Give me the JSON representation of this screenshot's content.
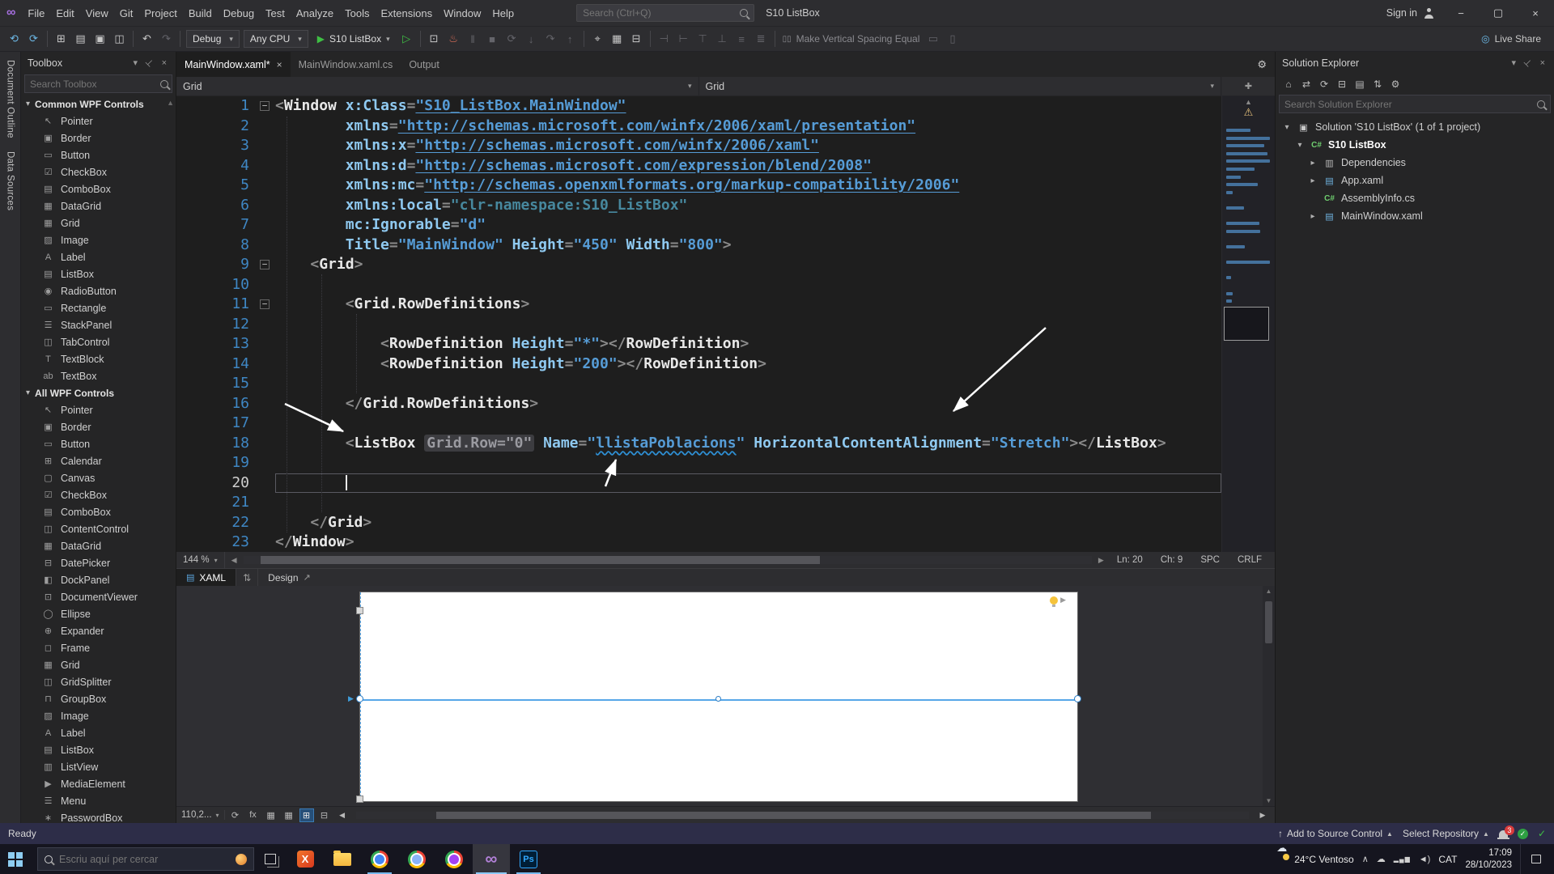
{
  "colors": {
    "accent": "#007acc",
    "statusbar-bg": "#2d2d48",
    "taskbar-bg": "#15151f",
    "tok-element": "#e8e8e8",
    "tok-attr": "#8fc9f0",
    "tok-value": "#569cd6",
    "tok-delim": "#8a8a8a",
    "tok-dim": "#47889e"
  },
  "icons": {
    "nav-back": "⟲",
    "nav-forward": "⟳",
    "new-project": "⊞",
    "open-file": "▤",
    "save": "▣",
    "save-all": "◫",
    "undo": "↶",
    "redo": "↷",
    "run": "▶",
    "run-outline": "▷",
    "chevron-down": "▾",
    "attach": "⊡",
    "hot-reload": "♨",
    "pause": "‖",
    "stop": "■",
    "restart": "⟳",
    "step-into": "↓",
    "step-over": "↷",
    "step-out": "↑",
    "target": "⌖",
    "device": "▦",
    "split": "⊟",
    "align-1": "⊣",
    "align-2": "⊢",
    "align-3": "⊤",
    "align-4": "⊥",
    "align-5": "≡",
    "align-6": "≣",
    "spacing": "▯▯",
    "misc-1": "▭",
    "misc-2": "▯",
    "live-share": "◎",
    "gear": "⚙",
    "split-editor": "✚",
    "warning": "⚠",
    "scroll-up": "▲",
    "scroll-down": "▼",
    "swap": "⇅",
    "popout": "↗",
    "xaml-doc": "▤",
    "home": "⌂",
    "switch-view": "⇄",
    "refresh": "⟳",
    "collapse-all": "⊟",
    "show-all": "▤",
    "sync": "⇅",
    "properties": "⚙",
    "menu-chevron": "▾",
    "close": "×",
    "left": "◀",
    "right": "▶",
    "tray-chevron": "∧",
    "onedrive": "☁",
    "network": "▂▄▆",
    "volume": "◄)",
    "publish": "↑"
  },
  "titlebar": {
    "menus": [
      "File",
      "Edit",
      "View",
      "Git",
      "Project",
      "Build",
      "Debug",
      "Test",
      "Analyze",
      "Tools",
      "Extensions",
      "Window",
      "Help"
    ],
    "search_placeholder": "Search (Ctrl+Q)",
    "window_title": "S10 ListBox",
    "sign_in": "Sign in",
    "window_controls": {
      "minimize": "−",
      "maximize": "▢",
      "close": "×"
    }
  },
  "toolbar": {
    "debug_target": "Debug",
    "platform": "Any CPU",
    "run_label": "S10 ListBox",
    "spacing_label": "Make Vertical Spacing Equal",
    "live_share": "Live Share"
  },
  "side_strip": {
    "tabs": [
      "Document Outline",
      "Data Sources"
    ]
  },
  "toolbox": {
    "title": "Toolbox",
    "search_placeholder": "Search Toolbox",
    "groups": [
      {
        "label": "Common WPF Controls",
        "items": [
          {
            "icon": "↖",
            "label": "Pointer"
          },
          {
            "icon": "▣",
            "label": "Border"
          },
          {
            "icon": "▭",
            "label": "Button"
          },
          {
            "icon": "☑",
            "label": "CheckBox"
          },
          {
            "icon": "▤",
            "label": "ComboBox"
          },
          {
            "icon": "▦",
            "label": "DataGrid"
          },
          {
            "icon": "▦",
            "label": "Grid"
          },
          {
            "icon": "▨",
            "label": "Image"
          },
          {
            "icon": "A",
            "label": "Label"
          },
          {
            "icon": "▤",
            "label": "ListBox"
          },
          {
            "icon": "◉",
            "label": "RadioButton"
          },
          {
            "icon": "▭",
            "label": "Rectangle"
          },
          {
            "icon": "☰",
            "label": "StackPanel"
          },
          {
            "icon": "◫",
            "label": "TabControl"
          },
          {
            "icon": "T",
            "label": "TextBlock"
          },
          {
            "icon": "ab",
            "label": "TextBox"
          }
        ]
      },
      {
        "label": "All WPF Controls",
        "items": [
          {
            "icon": "↖",
            "label": "Pointer"
          },
          {
            "icon": "▣",
            "label": "Border"
          },
          {
            "icon": "▭",
            "label": "Button"
          },
          {
            "icon": "⊞",
            "label": "Calendar"
          },
          {
            "icon": "▢",
            "label": "Canvas"
          },
          {
            "icon": "☑",
            "label": "CheckBox"
          },
          {
            "icon": "▤",
            "label": "ComboBox"
          },
          {
            "icon": "◫",
            "label": "ContentControl"
          },
          {
            "icon": "▦",
            "label": "DataGrid"
          },
          {
            "icon": "⊟",
            "label": "DatePicker"
          },
          {
            "icon": "◧",
            "label": "DockPanel"
          },
          {
            "icon": "⊡",
            "label": "DocumentViewer"
          },
          {
            "icon": "◯",
            "label": "Ellipse"
          },
          {
            "icon": "⊕",
            "label": "Expander"
          },
          {
            "icon": "◻",
            "label": "Frame"
          },
          {
            "icon": "▦",
            "label": "Grid"
          },
          {
            "icon": "◫",
            "label": "GridSplitter"
          },
          {
            "icon": "⊓",
            "label": "GroupBox"
          },
          {
            "icon": "▨",
            "label": "Image"
          },
          {
            "icon": "A",
            "label": "Label"
          },
          {
            "icon": "▤",
            "label": "ListBox"
          },
          {
            "icon": "▥",
            "label": "ListView"
          },
          {
            "icon": "▶",
            "label": "MediaElement"
          },
          {
            "icon": "☰",
            "label": "Menu"
          },
          {
            "icon": "∗",
            "label": "PasswordBox"
          }
        ]
      }
    ]
  },
  "editor": {
    "tabs": [
      {
        "label": "MainWindow.xaml*",
        "active": true
      },
      {
        "label": "MainWindow.xaml.cs",
        "active": false
      },
      {
        "label": "Output",
        "active": false
      }
    ],
    "breadcrumb": [
      "Grid",
      "Grid"
    ],
    "zoom": "144 %",
    "cursor_status": {
      "line": "Ln: 20",
      "column": "Ch: 9",
      "mode": "SPC",
      "eol": "CRLF"
    },
    "split_tabs": {
      "xaml": "XAML",
      "design": "Design"
    },
    "code_lines": [
      {
        "n": 1,
        "fold": true,
        "seg": [
          [
            "<",
            "d"
          ],
          [
            "Window",
            "e"
          ],
          [
            " ",
            "p"
          ],
          [
            "x:Class",
            "a"
          ],
          [
            "=",
            "d"
          ],
          [
            "\"S10_ListBox.MainWindow\"",
            "u"
          ]
        ]
      },
      {
        "n": 2,
        "seg": [
          [
            "        ",
            "p"
          ],
          [
            "xmlns",
            "a"
          ],
          [
            "=",
            "d"
          ],
          [
            "\"http://schemas.microsoft.com/winfx/2006/xaml/presentation\"",
            "u"
          ]
        ]
      },
      {
        "n": 3,
        "seg": [
          [
            "        ",
            "p"
          ],
          [
            "xmlns:x",
            "a"
          ],
          [
            "=",
            "d"
          ],
          [
            "\"http://schemas.microsoft.com/winfx/2006/xaml\"",
            "u"
          ]
        ]
      },
      {
        "n": 4,
        "seg": [
          [
            "        ",
            "p"
          ],
          [
            "xmlns:d",
            "a"
          ],
          [
            "=",
            "d"
          ],
          [
            "\"http://schemas.microsoft.com/expression/blend/2008\"",
            "u"
          ]
        ]
      },
      {
        "n": 5,
        "seg": [
          [
            "        ",
            "p"
          ],
          [
            "xmlns:mc",
            "a"
          ],
          [
            "=",
            "d"
          ],
          [
            "\"http://schemas.openxmlformats.org/markup-compatibility/2006\"",
            "u"
          ]
        ]
      },
      {
        "n": 6,
        "seg": [
          [
            "        ",
            "p"
          ],
          [
            "xmlns:local",
            "a"
          ],
          [
            "=",
            "d"
          ],
          [
            "\"clr-namespace:S10_ListBox\"",
            "m"
          ]
        ]
      },
      {
        "n": 7,
        "seg": [
          [
            "        ",
            "p"
          ],
          [
            "mc:Ignorable",
            "a"
          ],
          [
            "=",
            "d"
          ],
          [
            "\"d\"",
            "v"
          ]
        ]
      },
      {
        "n": 8,
        "seg": [
          [
            "        ",
            "p"
          ],
          [
            "Title",
            "a"
          ],
          [
            "=",
            "d"
          ],
          [
            "\"MainWindow\"",
            "v"
          ],
          [
            " ",
            "p"
          ],
          [
            "Height",
            "a"
          ],
          [
            "=",
            "d"
          ],
          [
            "\"450\"",
            "v"
          ],
          [
            " ",
            "p"
          ],
          [
            "Width",
            "a"
          ],
          [
            "=",
            "d"
          ],
          [
            "\"800\"",
            "v"
          ],
          [
            ">",
            "d"
          ]
        ]
      },
      {
        "n": 9,
        "fold": true,
        "seg": [
          [
            "    ",
            "p"
          ],
          [
            "<",
            "d"
          ],
          [
            "Grid",
            "e"
          ],
          [
            ">",
            "d"
          ]
        ]
      },
      {
        "n": 10,
        "seg": []
      },
      {
        "n": 11,
        "fold": true,
        "seg": [
          [
            "        ",
            "p"
          ],
          [
            "<",
            "d"
          ],
          [
            "Grid.RowDefinitions",
            "e"
          ],
          [
            ">",
            "d"
          ]
        ]
      },
      {
        "n": 12,
        "seg": []
      },
      {
        "n": 13,
        "seg": [
          [
            "            ",
            "p"
          ],
          [
            "<",
            "d"
          ],
          [
            "RowDefinition",
            "e"
          ],
          [
            " ",
            "p"
          ],
          [
            "Height",
            "a"
          ],
          [
            "=",
            "d"
          ],
          [
            "\"*\"",
            "v"
          ],
          [
            ">",
            "d"
          ],
          [
            "</",
            "d"
          ],
          [
            "RowDefinition",
            "e"
          ],
          [
            ">",
            "d"
          ]
        ]
      },
      {
        "n": 14,
        "seg": [
          [
            "            ",
            "p"
          ],
          [
            "<",
            "d"
          ],
          [
            "RowDefinition",
            "e"
          ],
          [
            " ",
            "p"
          ],
          [
            "Height",
            "a"
          ],
          [
            "=",
            "d"
          ],
          [
            "\"200\"",
            "v"
          ],
          [
            ">",
            "d"
          ],
          [
            "</",
            "d"
          ],
          [
            "RowDefinition",
            "e"
          ],
          [
            ">",
            "d"
          ]
        ]
      },
      {
        "n": 15,
        "seg": []
      },
      {
        "n": 16,
        "seg": [
          [
            "        ",
            "p"
          ],
          [
            "</",
            "d"
          ],
          [
            "Grid.RowDefinitions",
            "e"
          ],
          [
            ">",
            "d"
          ]
        ]
      },
      {
        "n": 17,
        "seg": []
      },
      {
        "n": 18,
        "seg": [
          [
            "        ",
            "p"
          ],
          [
            "<",
            "d"
          ],
          [
            "ListBox",
            "e"
          ],
          [
            " ",
            "p"
          ],
          [
            "Grid.Row=\"0\"",
            "g"
          ],
          [
            " ",
            "p"
          ],
          [
            "Name",
            "a"
          ],
          [
            "=",
            "d"
          ],
          [
            "\"",
            "v"
          ],
          [
            "llistaPoblacions",
            "w"
          ],
          [
            "\"",
            "v"
          ],
          [
            " ",
            "p"
          ],
          [
            "HorizontalContentAlignment",
            "a"
          ],
          [
            "=",
            "d"
          ],
          [
            "\"Stretch\"",
            "v"
          ],
          [
            ">",
            "d"
          ],
          [
            "</",
            "d"
          ],
          [
            "ListBox",
            "e"
          ],
          [
            ">",
            "d"
          ]
        ]
      },
      {
        "n": 19,
        "seg": []
      },
      {
        "n": 20,
        "cur": true,
        "caret": true,
        "seg": [
          [
            "        ",
            "p"
          ]
        ]
      },
      {
        "n": 21,
        "seg": []
      },
      {
        "n": 22,
        "seg": [
          [
            "    ",
            "p"
          ],
          [
            "</",
            "d"
          ],
          [
            "Grid",
            "e"
          ],
          [
            ">",
            "d"
          ]
        ]
      },
      {
        "n": 23,
        "seg": [
          [
            "</",
            "d"
          ],
          [
            "Window",
            "e"
          ],
          [
            ">",
            "d"
          ]
        ]
      }
    ]
  },
  "designer": {
    "zoom": "110,2...",
    "effects_label": "fx"
  },
  "solution_explorer": {
    "title": "Solution Explorer",
    "search_placeholder": "Search Solution Explorer",
    "tree": [
      {
        "label": "Solution 'S10 ListBox' (1 of 1 project)",
        "icon": "solution",
        "indent": 0,
        "state": "expanded"
      },
      {
        "label": "S10 ListBox",
        "icon": "csproj",
        "indent": 1,
        "state": "expanded",
        "bold": true
      },
      {
        "label": "Dependencies",
        "icon": "deps",
        "indent": 2,
        "state": "collapsed"
      },
      {
        "label": "App.xaml",
        "icon": "xaml",
        "indent": 2,
        "state": "collapsed"
      },
      {
        "label": "AssemblyInfo.cs",
        "icon": "cs",
        "indent": 2,
        "state": "none"
      },
      {
        "label": "MainWindow.xaml",
        "icon": "xaml",
        "indent": 2,
        "state": "collapsed"
      }
    ]
  },
  "statusbar": {
    "ready": "Ready",
    "add_to_source": "Add to Source Control",
    "select_repo": "Select Repository",
    "notification_count": "3"
  },
  "taskbar": {
    "search_placeholder": "Escriu aquí per cercar",
    "apps": [
      {
        "id": "x",
        "glyph": "X",
        "running": false,
        "active": false
      },
      {
        "id": "folder",
        "running": false,
        "active": false
      },
      {
        "id": "chrome",
        "running": true,
        "active": false
      },
      {
        "id": "chrome2",
        "running": false,
        "active": false
      },
      {
        "id": "chrome3",
        "running": false,
        "active": false
      },
      {
        "id": "vs",
        "glyph": "∞",
        "running": false,
        "active": true
      },
      {
        "id": "ps",
        "glyph": "Ps",
        "running": true,
        "active": false
      }
    ],
    "tray": {
      "weather": "24°C Ventoso",
      "lang": "CAT",
      "time": "17:09",
      "date": "28/10/2023"
    }
  }
}
